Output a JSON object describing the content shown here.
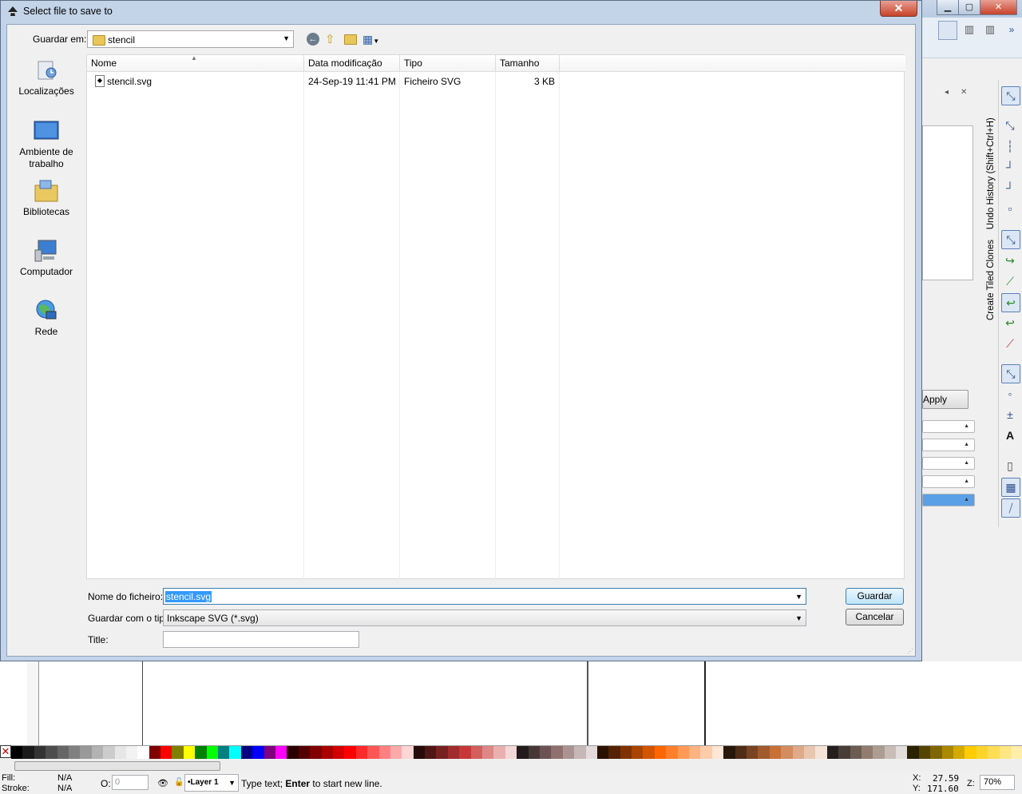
{
  "dialog": {
    "title": "Select file to save to",
    "close_glyph": "✕",
    "look_in_label": "Guardar em:",
    "look_in_value": "stencil",
    "places": [
      {
        "label": "Localizações",
        "icon": "recent-places-icon"
      },
      {
        "label": "Ambiente de trabalho",
        "icon": "desktop-icon"
      },
      {
        "label": "Bibliotecas",
        "icon": "libraries-icon"
      },
      {
        "label": "Computador",
        "icon": "computer-icon"
      },
      {
        "label": "Rede",
        "icon": "network-icon"
      }
    ],
    "columns": [
      "Nome",
      "Data modificação",
      "Tipo",
      "Tamanho"
    ],
    "files": [
      {
        "name": "stencil.svg",
        "modified": "24-Sep-19 11:41 PM",
        "type": "Ficheiro SVG",
        "size": "3 KB"
      }
    ],
    "filename_label": "Nome do ficheiro:",
    "filename_value": "stencil.svg",
    "filetype_label": "Guardar com o tipo:",
    "filetype_value": "Inkscape SVG (*.svg)",
    "title_label": "Title:",
    "title_value": "",
    "save_button": "Guardar",
    "cancel_button": "Cancelar"
  },
  "background": {
    "apply_button": "Apply",
    "vertical_tabs": [
      "Undo History (Shift+Ctrl+H)",
      "Create Tiled Clones"
    ],
    "palette_colors": [
      "#000000",
      "#1a1a1a",
      "#333333",
      "#4d4d4d",
      "#666666",
      "#808080",
      "#999999",
      "#b3b3b3",
      "#cccccc",
      "#e6e6e6",
      "#f2f2f2",
      "#ffffff",
      "#800000",
      "#ff0000",
      "#808000",
      "#ffff00",
      "#008000",
      "#00ff00",
      "#008080",
      "#00ffff",
      "#000080",
      "#0000ff",
      "#800080",
      "#ff00ff",
      "#2b0000",
      "#550000",
      "#800000",
      "#aa0000",
      "#d40000",
      "#ff0000",
      "#ff2a2a",
      "#ff5555",
      "#ff8080",
      "#ffaaaa",
      "#ffd5d5",
      "#280b0b",
      "#501616",
      "#782121",
      "#a02c2c",
      "#c83737",
      "#d35f5f",
      "#de8787",
      "#e9afaf",
      "#f4d7d7",
      "#241c1c",
      "#483737",
      "#6c5353",
      "#916f6f",
      "#ac9393",
      "#c8b7b7",
      "#e3dbdb",
      "#2b1100",
      "#552200",
      "#803300",
      "#aa4400",
      "#d45500",
      "#ff6600",
      "#ff7f2a",
      "#ff9955",
      "#ffb380",
      "#ffccaa",
      "#ffe6d5",
      "#28170b",
      "#502d16",
      "#784421",
      "#a05a2c",
      "#c87137",
      "#d38d5f",
      "#deaa87",
      "#e9c6af",
      "#f4e3d7",
      "#241f1c",
      "#483e37",
      "#6c5d53",
      "#917c6f",
      "#ac9d93",
      "#c8beb7",
      "#e3dedb",
      "#2b2200",
      "#554400",
      "#806600",
      "#aa8800",
      "#d4aa00",
      "#ffcc00",
      "#ffd42a",
      "#ffdd55",
      "#ffe680",
      "#ffeeaa"
    ]
  },
  "status": {
    "fill_label": "Fill:",
    "fill_value": "N/A",
    "stroke_label": "Stroke:",
    "stroke_value": "N/A",
    "opacity_label": "O:",
    "opacity_value": "0",
    "layer": "•Layer 1",
    "message_bold": "Enter",
    "message_pre": "Type text; ",
    "message_post": " to start new line.",
    "x_label": "X:",
    "x_value": "27.59",
    "y_label": "Y:",
    "y_value": "171.60",
    "zoom_label": "Z:",
    "zoom_value": "70%"
  }
}
